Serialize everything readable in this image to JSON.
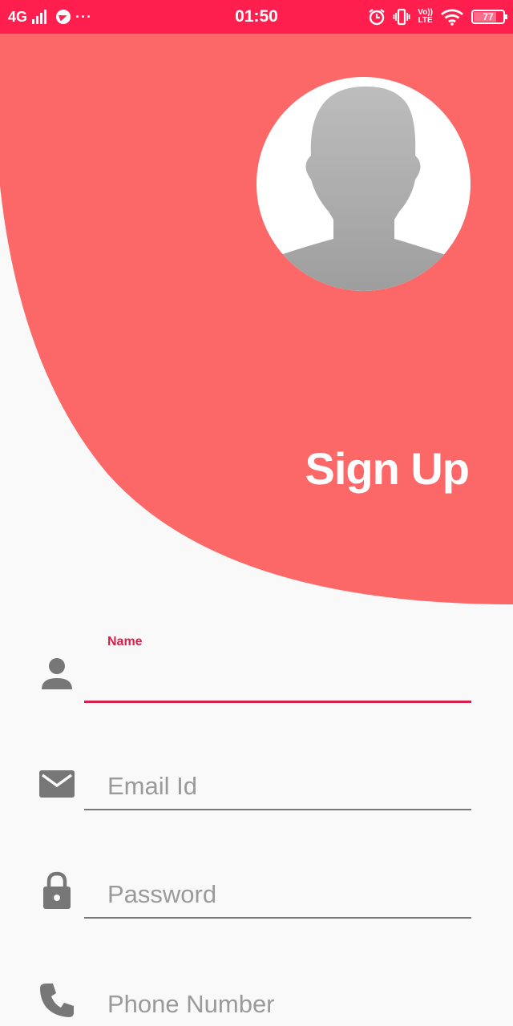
{
  "status_bar": {
    "network": "4G",
    "dots": "···",
    "time": "01:50",
    "volte_top": "Vo))",
    "volte_bottom": "LTE",
    "battery": "77",
    "battery_level": 0.77,
    "background": "#ff1f4e"
  },
  "header": {
    "title": "Sign Up",
    "color": "#fc6767",
    "avatar_icon": "person-silhouette"
  },
  "form": {
    "name": {
      "label": "Name",
      "value": "",
      "icon": "person-icon"
    },
    "email": {
      "placeholder": "Email Id",
      "icon": "mail-icon"
    },
    "password": {
      "placeholder": "Password",
      "icon": "lock-icon"
    },
    "phone": {
      "placeholder": "Phone Number",
      "icon": "phone-icon"
    }
  },
  "colors": {
    "accent": "#d6214b",
    "background": "#f9f9f9",
    "icon": "#777777"
  }
}
